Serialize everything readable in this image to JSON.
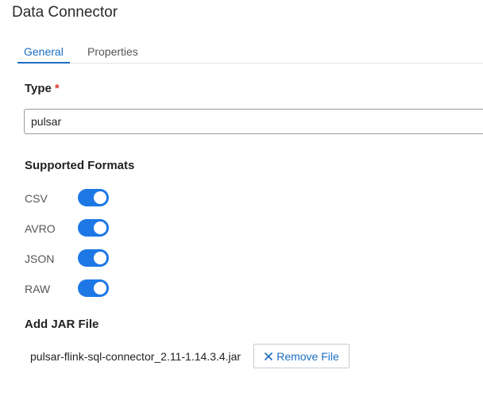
{
  "page": {
    "title": "Data Connector"
  },
  "tabs": [
    {
      "label": "General",
      "active": true
    },
    {
      "label": "Properties",
      "active": false
    }
  ],
  "type_section": {
    "label": "Type",
    "required_marker": "*",
    "value": "pulsar"
  },
  "formats_section": {
    "label": "Supported Formats",
    "formats": [
      {
        "label": "CSV",
        "enabled": true
      },
      {
        "label": "AVRO",
        "enabled": true
      },
      {
        "label": "JSON",
        "enabled": true
      },
      {
        "label": "RAW",
        "enabled": true
      }
    ]
  },
  "jar_section": {
    "label": "Add JAR File",
    "file_name": "pulsar-flink-sql-connector_2.11-1.14.3.4.jar",
    "remove_label": "Remove File",
    "remove_icon": "close-icon"
  },
  "colors": {
    "accent": "#1b6ec2",
    "toggle_on": "#1d78e6",
    "required": "#d9372c"
  }
}
